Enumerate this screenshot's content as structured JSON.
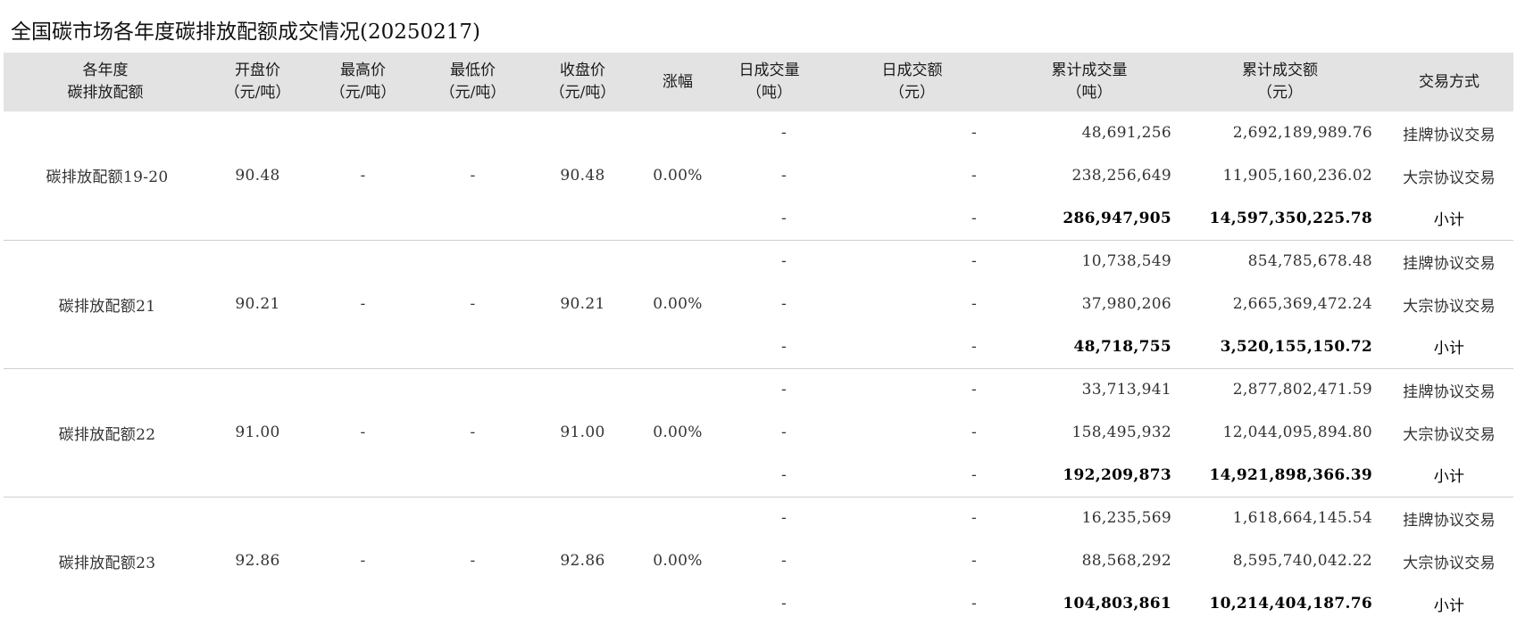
{
  "title": "全国碳市场各年度碳排放配额成交情况(20250217)",
  "table": {
    "headers": [
      {
        "line1": "各年度",
        "line2": "碳排放配额"
      },
      {
        "line1": "开盘价",
        "line2": "（元/吨）"
      },
      {
        "line1": "最高价",
        "line2": "（元/吨）"
      },
      {
        "line1": "最低价",
        "line2": "（元/吨）"
      },
      {
        "line1": "收盘价",
        "line2": "（元/吨）"
      },
      {
        "line1": "涨幅",
        "line2": ""
      },
      {
        "line1": "日成交量",
        "line2": "（吨）"
      },
      {
        "line1": "日成交额",
        "line2": "（元）"
      },
      {
        "line1": "累计成交量",
        "line2": "（吨）"
      },
      {
        "line1": "累计成交额",
        "line2": "（元）"
      },
      {
        "line1": "交易方式",
        "line2": ""
      }
    ],
    "groups": [
      {
        "name": "碳排放配额19-20",
        "open": "90.48",
        "high": "-",
        "low": "-",
        "close": "90.48",
        "change": "0.00%",
        "rows": [
          {
            "day_volume": "-",
            "day_amount": "-",
            "cum_volume": "48,691,256",
            "cum_amount": "2,692,189,989.76",
            "method": "挂牌协议交易"
          },
          {
            "day_volume": "-",
            "day_amount": "-",
            "cum_volume": "238,256,649",
            "cum_amount": "11,905,160,236.02",
            "method": "大宗协议交易"
          },
          {
            "day_volume": "-",
            "day_amount": "-",
            "cum_volume": "286,947,905",
            "cum_amount": "14,597,350,225.78",
            "method": "小计"
          }
        ]
      },
      {
        "name": "碳排放配额21",
        "open": "90.21",
        "high": "-",
        "low": "-",
        "close": "90.21",
        "change": "0.00%",
        "rows": [
          {
            "day_volume": "-",
            "day_amount": "-",
            "cum_volume": "10,738,549",
            "cum_amount": "854,785,678.48",
            "method": "挂牌协议交易"
          },
          {
            "day_volume": "-",
            "day_amount": "-",
            "cum_volume": "37,980,206",
            "cum_amount": "2,665,369,472.24",
            "method": "大宗协议交易"
          },
          {
            "day_volume": "-",
            "day_amount": "-",
            "cum_volume": "48,718,755",
            "cum_amount": "3,520,155,150.72",
            "method": "小计"
          }
        ]
      },
      {
        "name": "碳排放配额22",
        "open": "91.00",
        "high": "-",
        "low": "-",
        "close": "91.00",
        "change": "0.00%",
        "rows": [
          {
            "day_volume": "-",
            "day_amount": "-",
            "cum_volume": "33,713,941",
            "cum_amount": "2,877,802,471.59",
            "method": "挂牌协议交易"
          },
          {
            "day_volume": "-",
            "day_amount": "-",
            "cum_volume": "158,495,932",
            "cum_amount": "12,044,095,894.80",
            "method": "大宗协议交易"
          },
          {
            "day_volume": "-",
            "day_amount": "-",
            "cum_volume": "192,209,873",
            "cum_amount": "14,921,898,366.39",
            "method": "小计"
          }
        ]
      },
      {
        "name": "碳排放配额23",
        "open": "92.86",
        "high": "-",
        "low": "-",
        "close": "92.86",
        "change": "0.00%",
        "rows": [
          {
            "day_volume": "-",
            "day_amount": "-",
            "cum_volume": "16,235,569",
            "cum_amount": "1,618,664,145.54",
            "method": "挂牌协议交易"
          },
          {
            "day_volume": "-",
            "day_amount": "-",
            "cum_volume": "88,568,292",
            "cum_amount": "8,595,740,042.22",
            "method": "大宗协议交易"
          },
          {
            "day_volume": "-",
            "day_amount": "-",
            "cum_volume": "104,803,861",
            "cum_amount": "10,214,404,187.76",
            "method": "小计"
          }
        ]
      }
    ]
  }
}
